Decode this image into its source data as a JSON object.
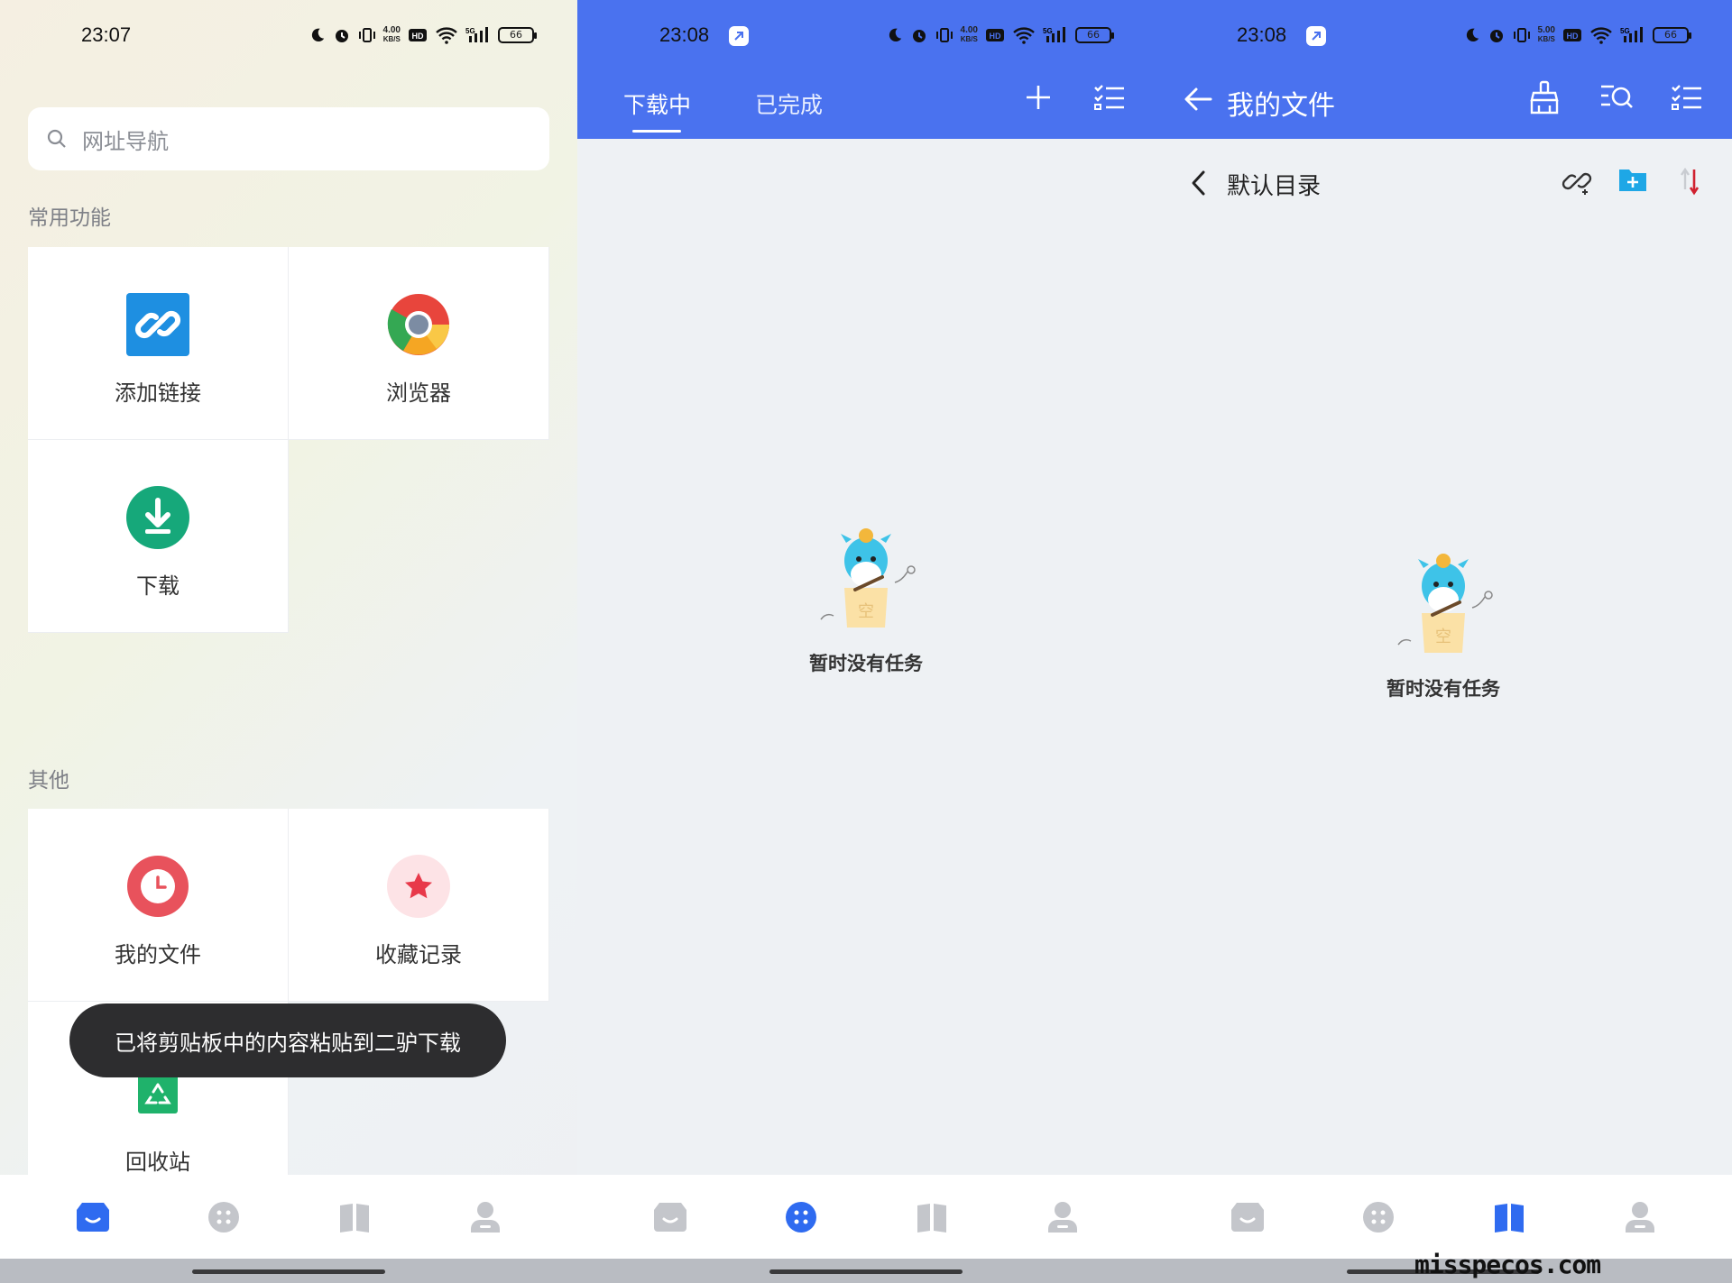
{
  "screen1": {
    "status": {
      "time": "23:07",
      "net_speed_top": "4.00",
      "net_speed_unit": "KB/S",
      "battery": "66",
      "signal": "5G",
      "hd": "HD"
    },
    "search": {
      "placeholder": "网址导航"
    },
    "section_common": "常用功能",
    "common_items": [
      {
        "label": "添加链接",
        "icon": "link-icon"
      },
      {
        "label": "浏览器",
        "icon": "browser-icon"
      },
      {
        "label": "下载",
        "icon": "download-icon"
      }
    ],
    "section_other": "其他",
    "other_items": [
      {
        "label": "我的文件",
        "icon": "clock-icon"
      },
      {
        "label": "收藏记录",
        "icon": "star-icon"
      },
      {
        "label": "回收站",
        "icon": "recycle-icon"
      }
    ],
    "toast": "已将剪贴板中的内容粘贴到二驴下载"
  },
  "screen2": {
    "status": {
      "time": "23:08",
      "net_speed_top": "4.00",
      "net_speed_unit": "KB/S",
      "battery": "66",
      "signal": "5G",
      "hd": "HD"
    },
    "tabs": [
      "下载中",
      "已完成"
    ],
    "active_tab": 0,
    "empty_text": "暂时没有任务",
    "empty_box_char": "空"
  },
  "screen3": {
    "status": {
      "time": "23:08",
      "net_speed_top": "5.00",
      "net_speed_unit": "KB/S",
      "battery": "66",
      "signal": "5G",
      "hd": "HD"
    },
    "title": "我的文件",
    "directory": "默认目录",
    "empty_text": "暂时没有任务",
    "empty_box_char": "空"
  },
  "colors": {
    "header_blue": "#4a72ef",
    "nav_active": "#2f6bf0",
    "nav_inactive": "#c4c6cb"
  },
  "watermark": "misspecos.com"
}
